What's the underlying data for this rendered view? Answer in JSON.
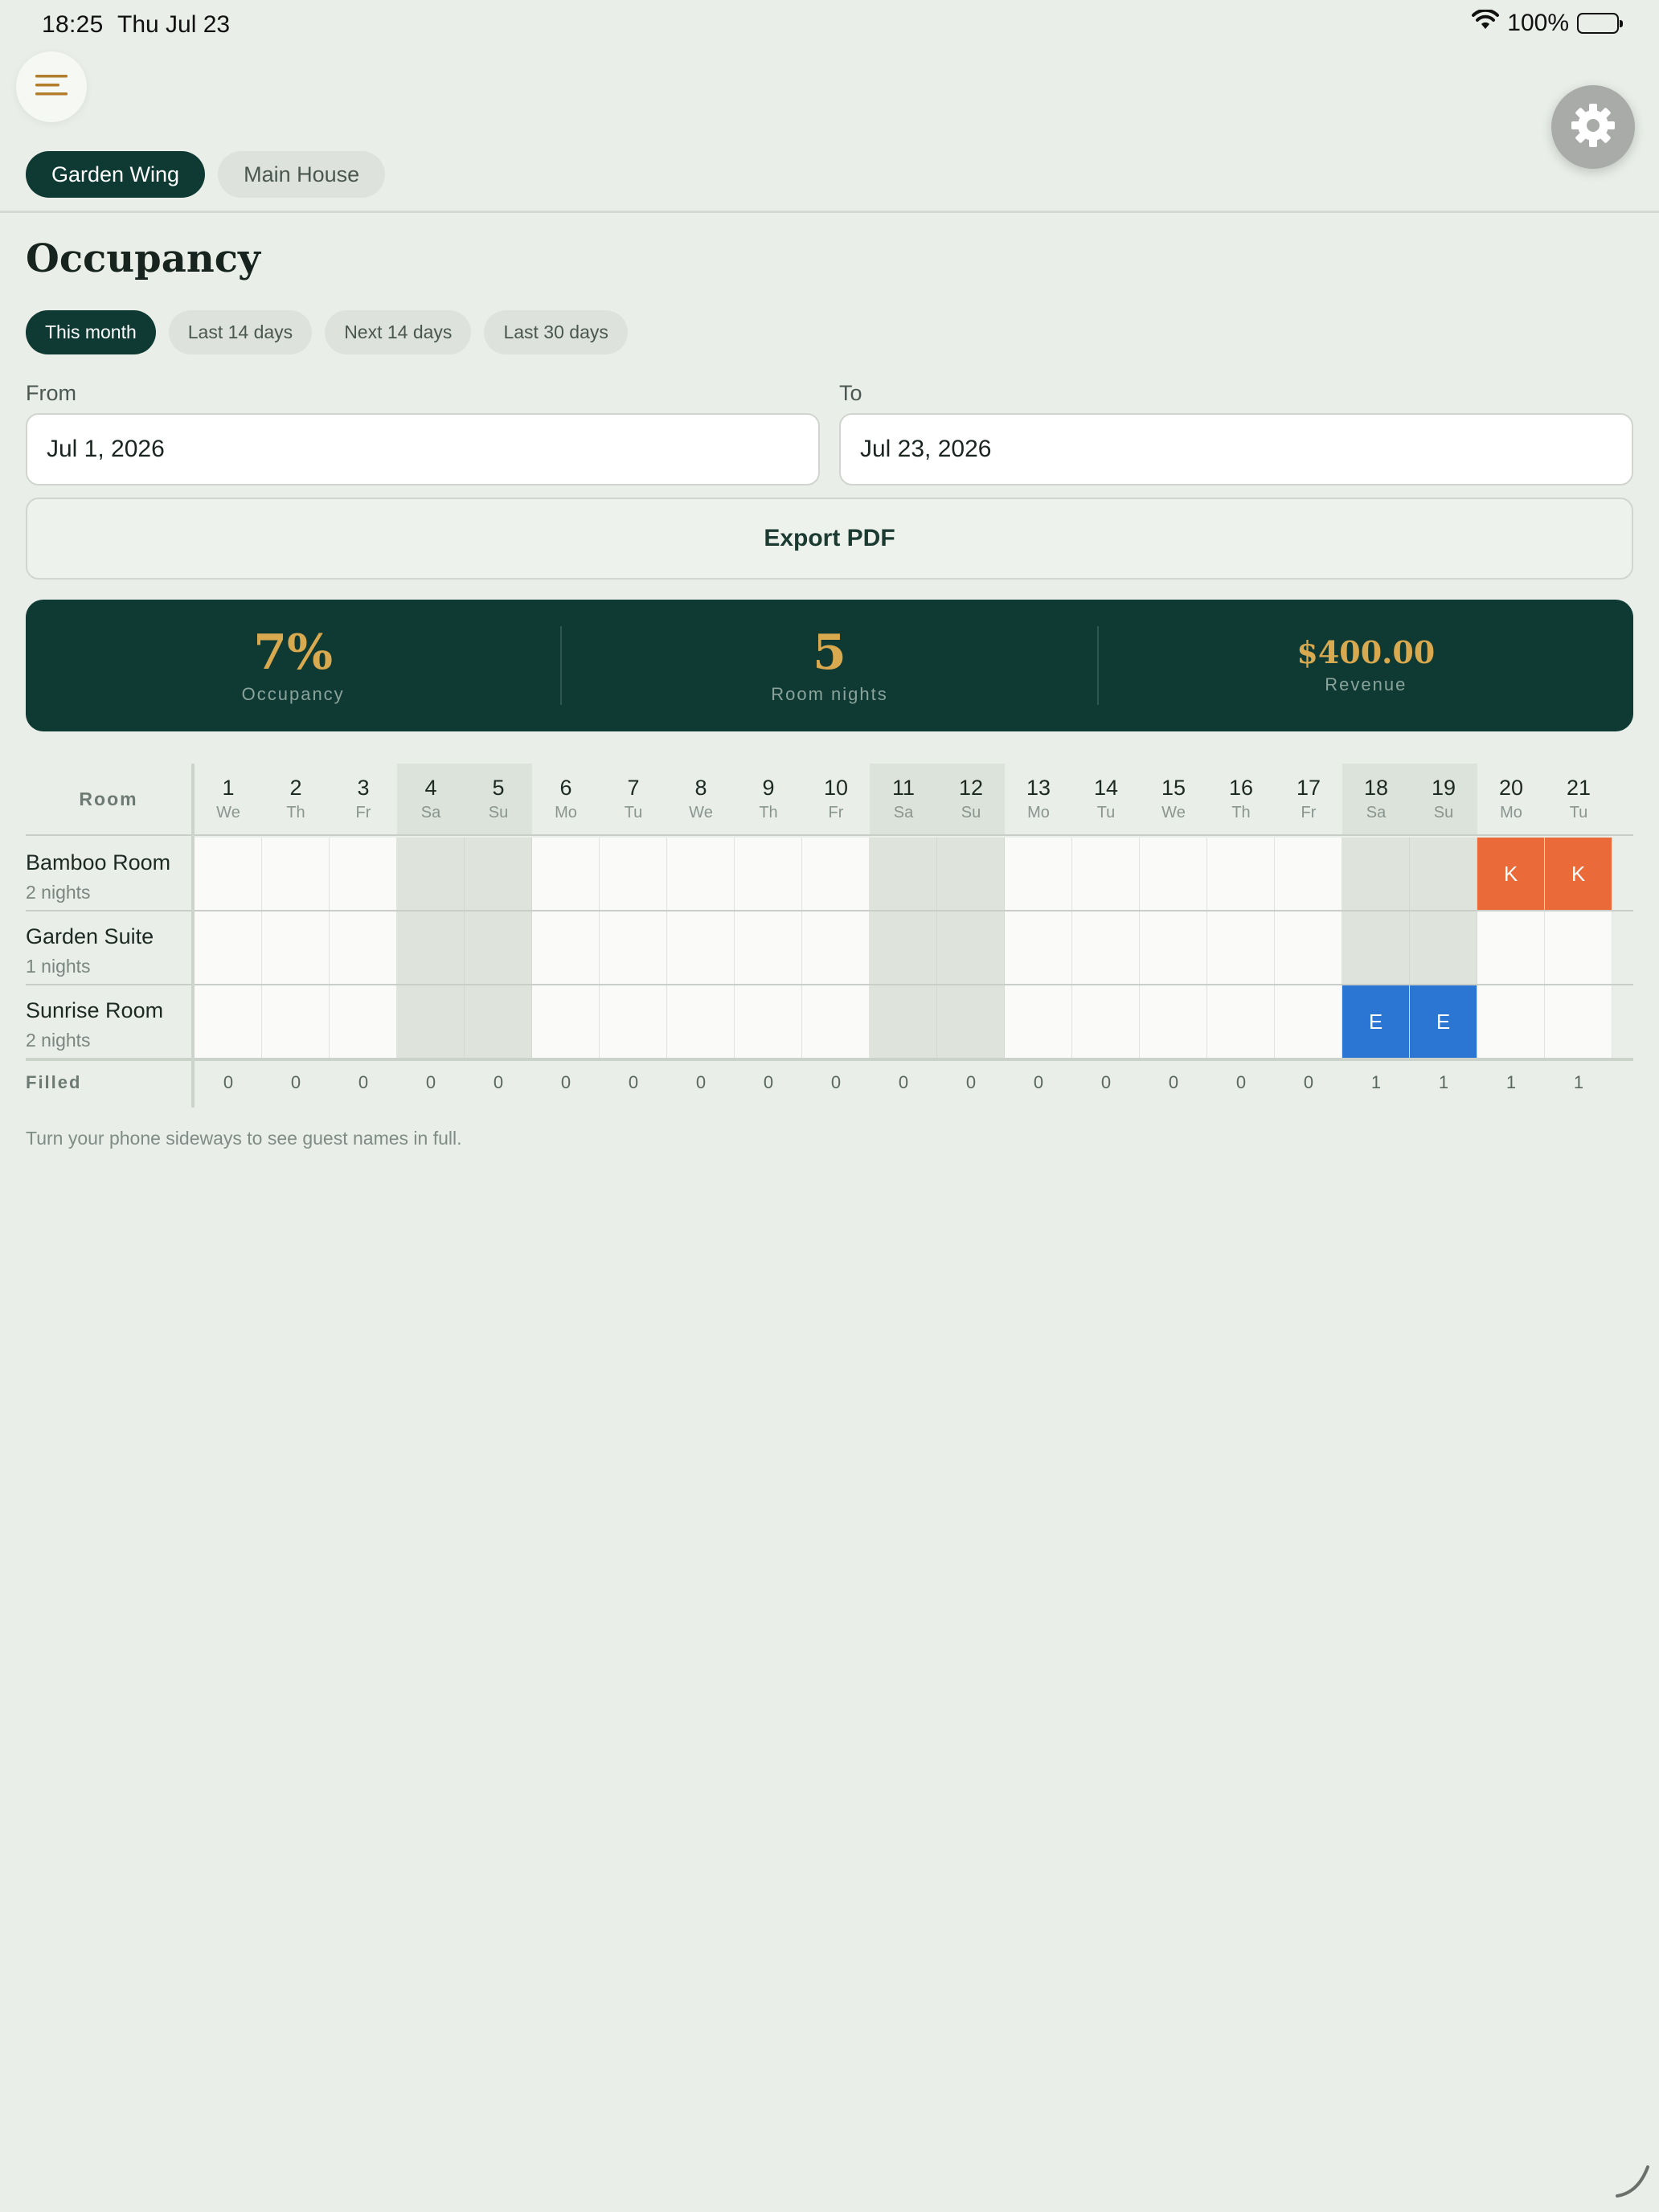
{
  "status_bar": {
    "time": "18:25",
    "date": "Thu Jul 23",
    "battery": "100%"
  },
  "icons": {
    "menu": "hamburger-menu-icon",
    "settings": "gear-icon",
    "wifi": "wifi-icon",
    "battery": "battery-icon"
  },
  "wing_tabs": [
    {
      "label": "Garden Wing",
      "active": true
    },
    {
      "label": "Main House",
      "active": false
    }
  ],
  "page_title": "Occupancy",
  "range_chips": [
    {
      "label": "This month",
      "active": true
    },
    {
      "label": "Last 14 days",
      "active": false
    },
    {
      "label": "Next 14 days",
      "active": false
    },
    {
      "label": "Last 30 days",
      "active": false
    }
  ],
  "from": {
    "label": "From",
    "value": "Jul 1, 2026"
  },
  "to": {
    "label": "To",
    "value": "Jul 23, 2026"
  },
  "export_label": "Export PDF",
  "stats": {
    "occupancy": {
      "value": "7%",
      "label": "Occupancy"
    },
    "room_nights": {
      "value": "5",
      "label": "Room nights"
    },
    "revenue": {
      "value": "$400.00",
      "label": "Revenue"
    }
  },
  "grid": {
    "room_header": "Room",
    "filled_label": "Filled",
    "days": [
      {
        "num": "1",
        "dow": "We",
        "weekend": false
      },
      {
        "num": "2",
        "dow": "Th",
        "weekend": false
      },
      {
        "num": "3",
        "dow": "Fr",
        "weekend": false
      },
      {
        "num": "4",
        "dow": "Sa",
        "weekend": true
      },
      {
        "num": "5",
        "dow": "Su",
        "weekend": true
      },
      {
        "num": "6",
        "dow": "Mo",
        "weekend": false
      },
      {
        "num": "7",
        "dow": "Tu",
        "weekend": false
      },
      {
        "num": "8",
        "dow": "We",
        "weekend": false
      },
      {
        "num": "9",
        "dow": "Th",
        "weekend": false
      },
      {
        "num": "10",
        "dow": "Fr",
        "weekend": false
      },
      {
        "num": "11",
        "dow": "Sa",
        "weekend": true
      },
      {
        "num": "12",
        "dow": "Su",
        "weekend": true
      },
      {
        "num": "13",
        "dow": "Mo",
        "weekend": false
      },
      {
        "num": "14",
        "dow": "Tu",
        "weekend": false
      },
      {
        "num": "15",
        "dow": "We",
        "weekend": false
      },
      {
        "num": "16",
        "dow": "Th",
        "weekend": false
      },
      {
        "num": "17",
        "dow": "Fr",
        "weekend": false
      },
      {
        "num": "18",
        "dow": "Sa",
        "weekend": true
      },
      {
        "num": "19",
        "dow": "Su",
        "weekend": true
      },
      {
        "num": "20",
        "dow": "Mo",
        "weekend": false
      },
      {
        "num": "21",
        "dow": "Tu",
        "weekend": false
      }
    ],
    "rooms": [
      {
        "name": "Bamboo Room",
        "nights": "2 nights",
        "bookings": [
          {
            "day": "20",
            "initial": "K",
            "color": "#ea6a3a"
          },
          {
            "day": "21",
            "initial": "K",
            "color": "#ea6a3a"
          }
        ]
      },
      {
        "name": "Garden Suite",
        "nights": "1 nights",
        "bookings": []
      },
      {
        "name": "Sunrise Room",
        "nights": "2 nights",
        "bookings": [
          {
            "day": "18",
            "initial": "E",
            "color": "#2a76d2"
          },
          {
            "day": "19",
            "initial": "E",
            "color": "#2a76d2"
          }
        ]
      }
    ],
    "filled": [
      "0",
      "0",
      "0",
      "0",
      "0",
      "0",
      "0",
      "0",
      "0",
      "0",
      "0",
      "0",
      "0",
      "0",
      "0",
      "0",
      "0",
      "1",
      "1",
      "1",
      "1"
    ]
  },
  "hint": "Turn your phone sideways to see guest names in full."
}
